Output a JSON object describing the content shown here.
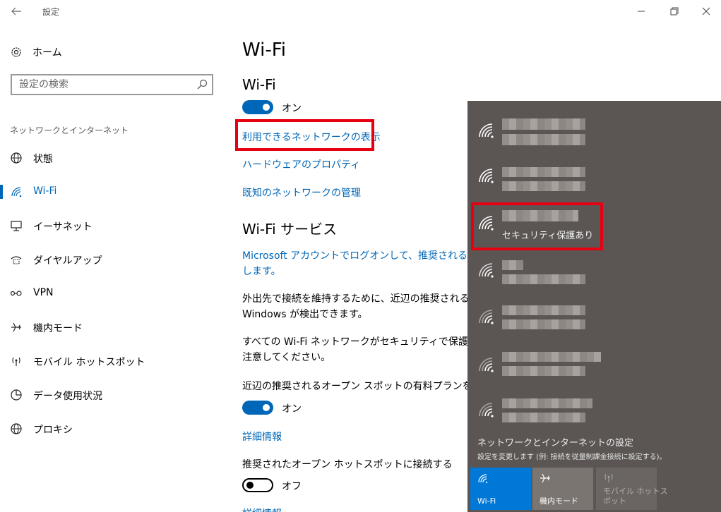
{
  "window": {
    "title": "設定"
  },
  "sidebar": {
    "home_label": "ホーム",
    "search_placeholder": "設定の検索",
    "section_label": "ネットワークとインターネット",
    "items": [
      {
        "label": "状態",
        "icon": "globe-icon"
      },
      {
        "label": "Wi-Fi",
        "icon": "wifi-icon",
        "active": true
      },
      {
        "label": "イーサネット",
        "icon": "ethernet-icon"
      },
      {
        "label": "ダイヤルアップ",
        "icon": "dialup-icon"
      },
      {
        "label": "VPN",
        "icon": "vpn-icon"
      },
      {
        "label": "機内モード",
        "icon": "airplane-icon"
      },
      {
        "label": "モバイル ホットスポット",
        "icon": "hotspot-icon"
      },
      {
        "label": "データ使用状況",
        "icon": "data-usage-icon"
      },
      {
        "label": "プロキシ",
        "icon": "proxy-globe-icon"
      }
    ]
  },
  "main": {
    "title": "Wi-Fi",
    "wifi_heading": "Wi-Fi",
    "wifi_toggle_label": "オン",
    "links": {
      "show_networks": "利用できるネットワークの表示",
      "hardware_properties": "ハードウェアのプロパティ",
      "manage_known": "既知のネットワークの管理"
    },
    "services_heading": "Wi-Fi サービス",
    "ms_account_line1": "Microsoft アカウントでログオンして、推奨されるオープン",
    "ms_account_line2": "します。",
    "keep_connected_line1": "外出先で接続を維持するために、近辺の推奨されるオー",
    "keep_connected_line2": "Windows が検出できます。",
    "security_note_line1": "すべての Wi-Fi ネットワークがセキュリティで保護されてい",
    "security_note_line2": "注意してください。",
    "paid_plans_label": "近辺の推奨されるオープン スポットの有料プランを探す",
    "paid_plans_toggle_label": "オン",
    "details_link_1": "詳細情報",
    "connect_hotspots_label": "推奨されたオープン ホットスポットに接続する",
    "connect_hotspots_toggle_label": "オフ",
    "details_link_2": "詳細情報"
  },
  "flyout": {
    "highlighted_network_status": "セキュリティ保護あり",
    "settings_title": "ネットワークとインターネットの設定",
    "settings_desc": "設定を変更します (例: 接続を従量制課金接続に設定する)。",
    "quick_actions": [
      {
        "label_line1": "Wi-Fi",
        "label_line2": "",
        "icon": "wifi-icon",
        "state": "on"
      },
      {
        "label_line1": "機内モード",
        "label_line2": "",
        "icon": "airplane-icon",
        "state": "off"
      },
      {
        "label_line1": "モバイル ホットス",
        "label_line2": "ポット",
        "icon": "hotspot-icon",
        "state": "disabled"
      }
    ]
  },
  "colors": {
    "accent": "#0067b8",
    "highlight_box": "#e60012",
    "flyout_bg": "#5b5653"
  }
}
